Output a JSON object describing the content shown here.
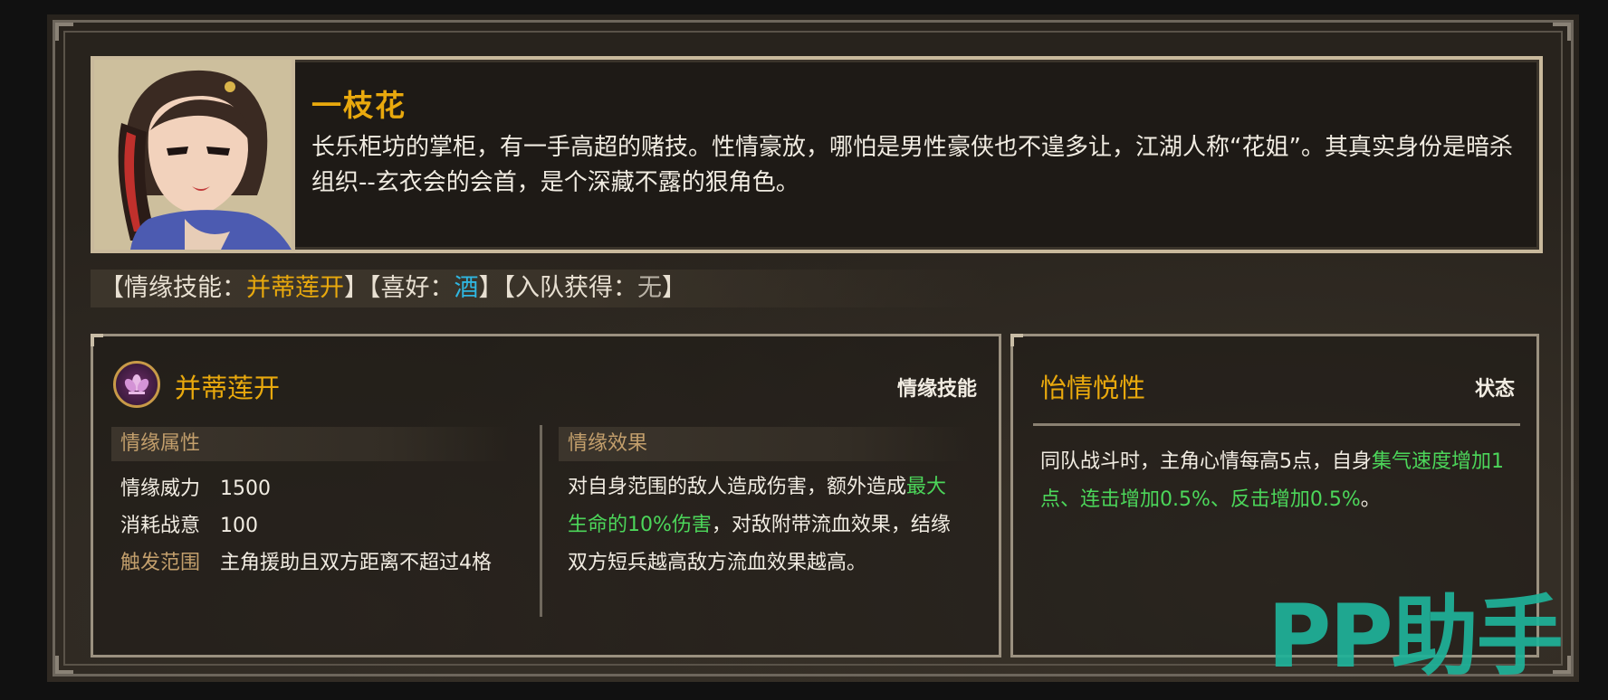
{
  "character": {
    "name": "一枝花",
    "description": "长乐柜坊的掌柜，有一手高超的赌技。性情豪放，哪怕是男性豪侠也不遑多让，江湖人称“花姐”。其真实身份是暗杀组织--玄衣会的会首，是个深藏不露的狠角色。"
  },
  "info_strip": {
    "skill_open": "【情缘技能：",
    "skill_value": "并蒂莲开",
    "skill_close": "】",
    "hobby_open": "【喜好：",
    "hobby_value": "酒",
    "hobby_close": "】",
    "join_open": "【入队获得：",
    "join_value": "无",
    "join_close": "】"
  },
  "skill": {
    "icon": "lotus-icon",
    "title": "并蒂莲开",
    "type": "情缘技能",
    "attr_header": "情缘属性",
    "attributes": [
      {
        "key": "情缘威力",
        "value": "1500"
      },
      {
        "key": "消耗战意",
        "value": "100"
      },
      {
        "key": "触发范围",
        "value": "主角援助且双方距离不超过4格"
      }
    ],
    "effect_header": "情缘效果",
    "effect_part1": "对自身范围的敌人造成伤害，额外造成",
    "effect_highlight": "最大生命的10%伤害",
    "effect_part2": "，对敌附带流血效果，结缘双方短兵越高敌方流血效果越高。"
  },
  "status": {
    "title": "怡情悦性",
    "type": "状态",
    "text_part1": "同队战斗时，主角心情每高5点，自身",
    "text_highlight": "集气速度增加1点、连击增加0.5%、反击增加0.5%",
    "text_part2": "。"
  },
  "watermark": "PP助手",
  "colors": {
    "accent_gold": "#e9a90d",
    "hobby_cyan": "#2fb6e0",
    "highlight_green": "#4cd65a",
    "watermark_teal": "#1fb39a"
  }
}
